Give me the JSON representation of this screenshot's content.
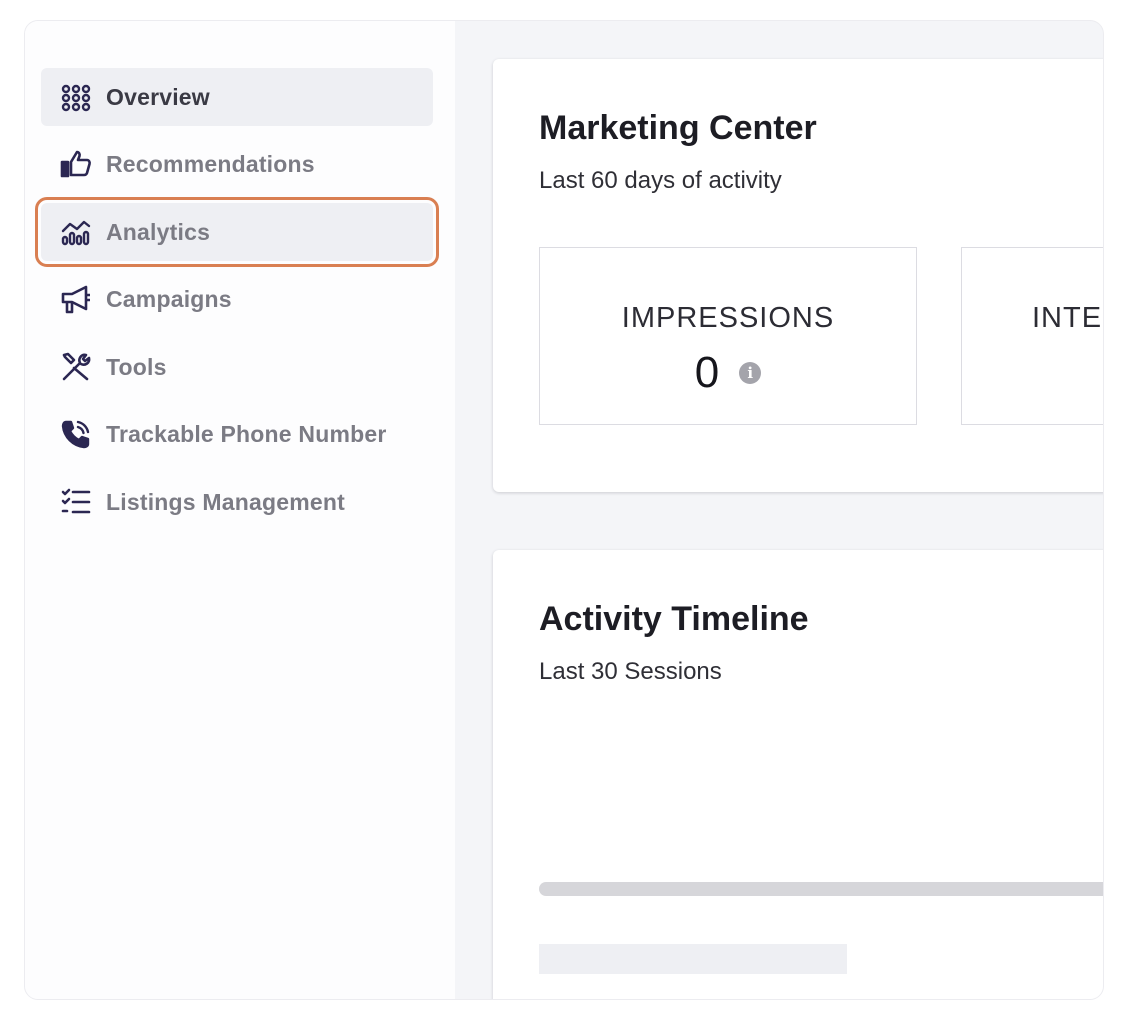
{
  "sidebar": {
    "items": [
      {
        "label": "Overview",
        "icon": "grid-icon"
      },
      {
        "label": "Recommendations",
        "icon": "thumbs-up-icon"
      },
      {
        "label": "Analytics",
        "icon": "analytics-chart-icon"
      },
      {
        "label": "Campaigns",
        "icon": "megaphone-icon"
      },
      {
        "label": "Tools",
        "icon": "tools-icon"
      },
      {
        "label": "Trackable Phone Number",
        "icon": "phone-ringing-icon"
      },
      {
        "label": "Listings Management",
        "icon": "checklist-icon"
      }
    ],
    "active_index": 0,
    "highlighted_index": 2
  },
  "marketing": {
    "title": "Marketing Center",
    "subtitle": "Last 60 days of activity",
    "metrics": [
      {
        "label": "IMPRESSIONS",
        "value": "0"
      },
      {
        "label": "INTE",
        "value": ""
      }
    ]
  },
  "timeline": {
    "title": "Activity Timeline",
    "subtitle": "Last 30 Sessions"
  },
  "colors": {
    "nav_icon": "#2b2752",
    "highlight_outline": "#d97f52",
    "active_bg": "#eeeff3"
  }
}
